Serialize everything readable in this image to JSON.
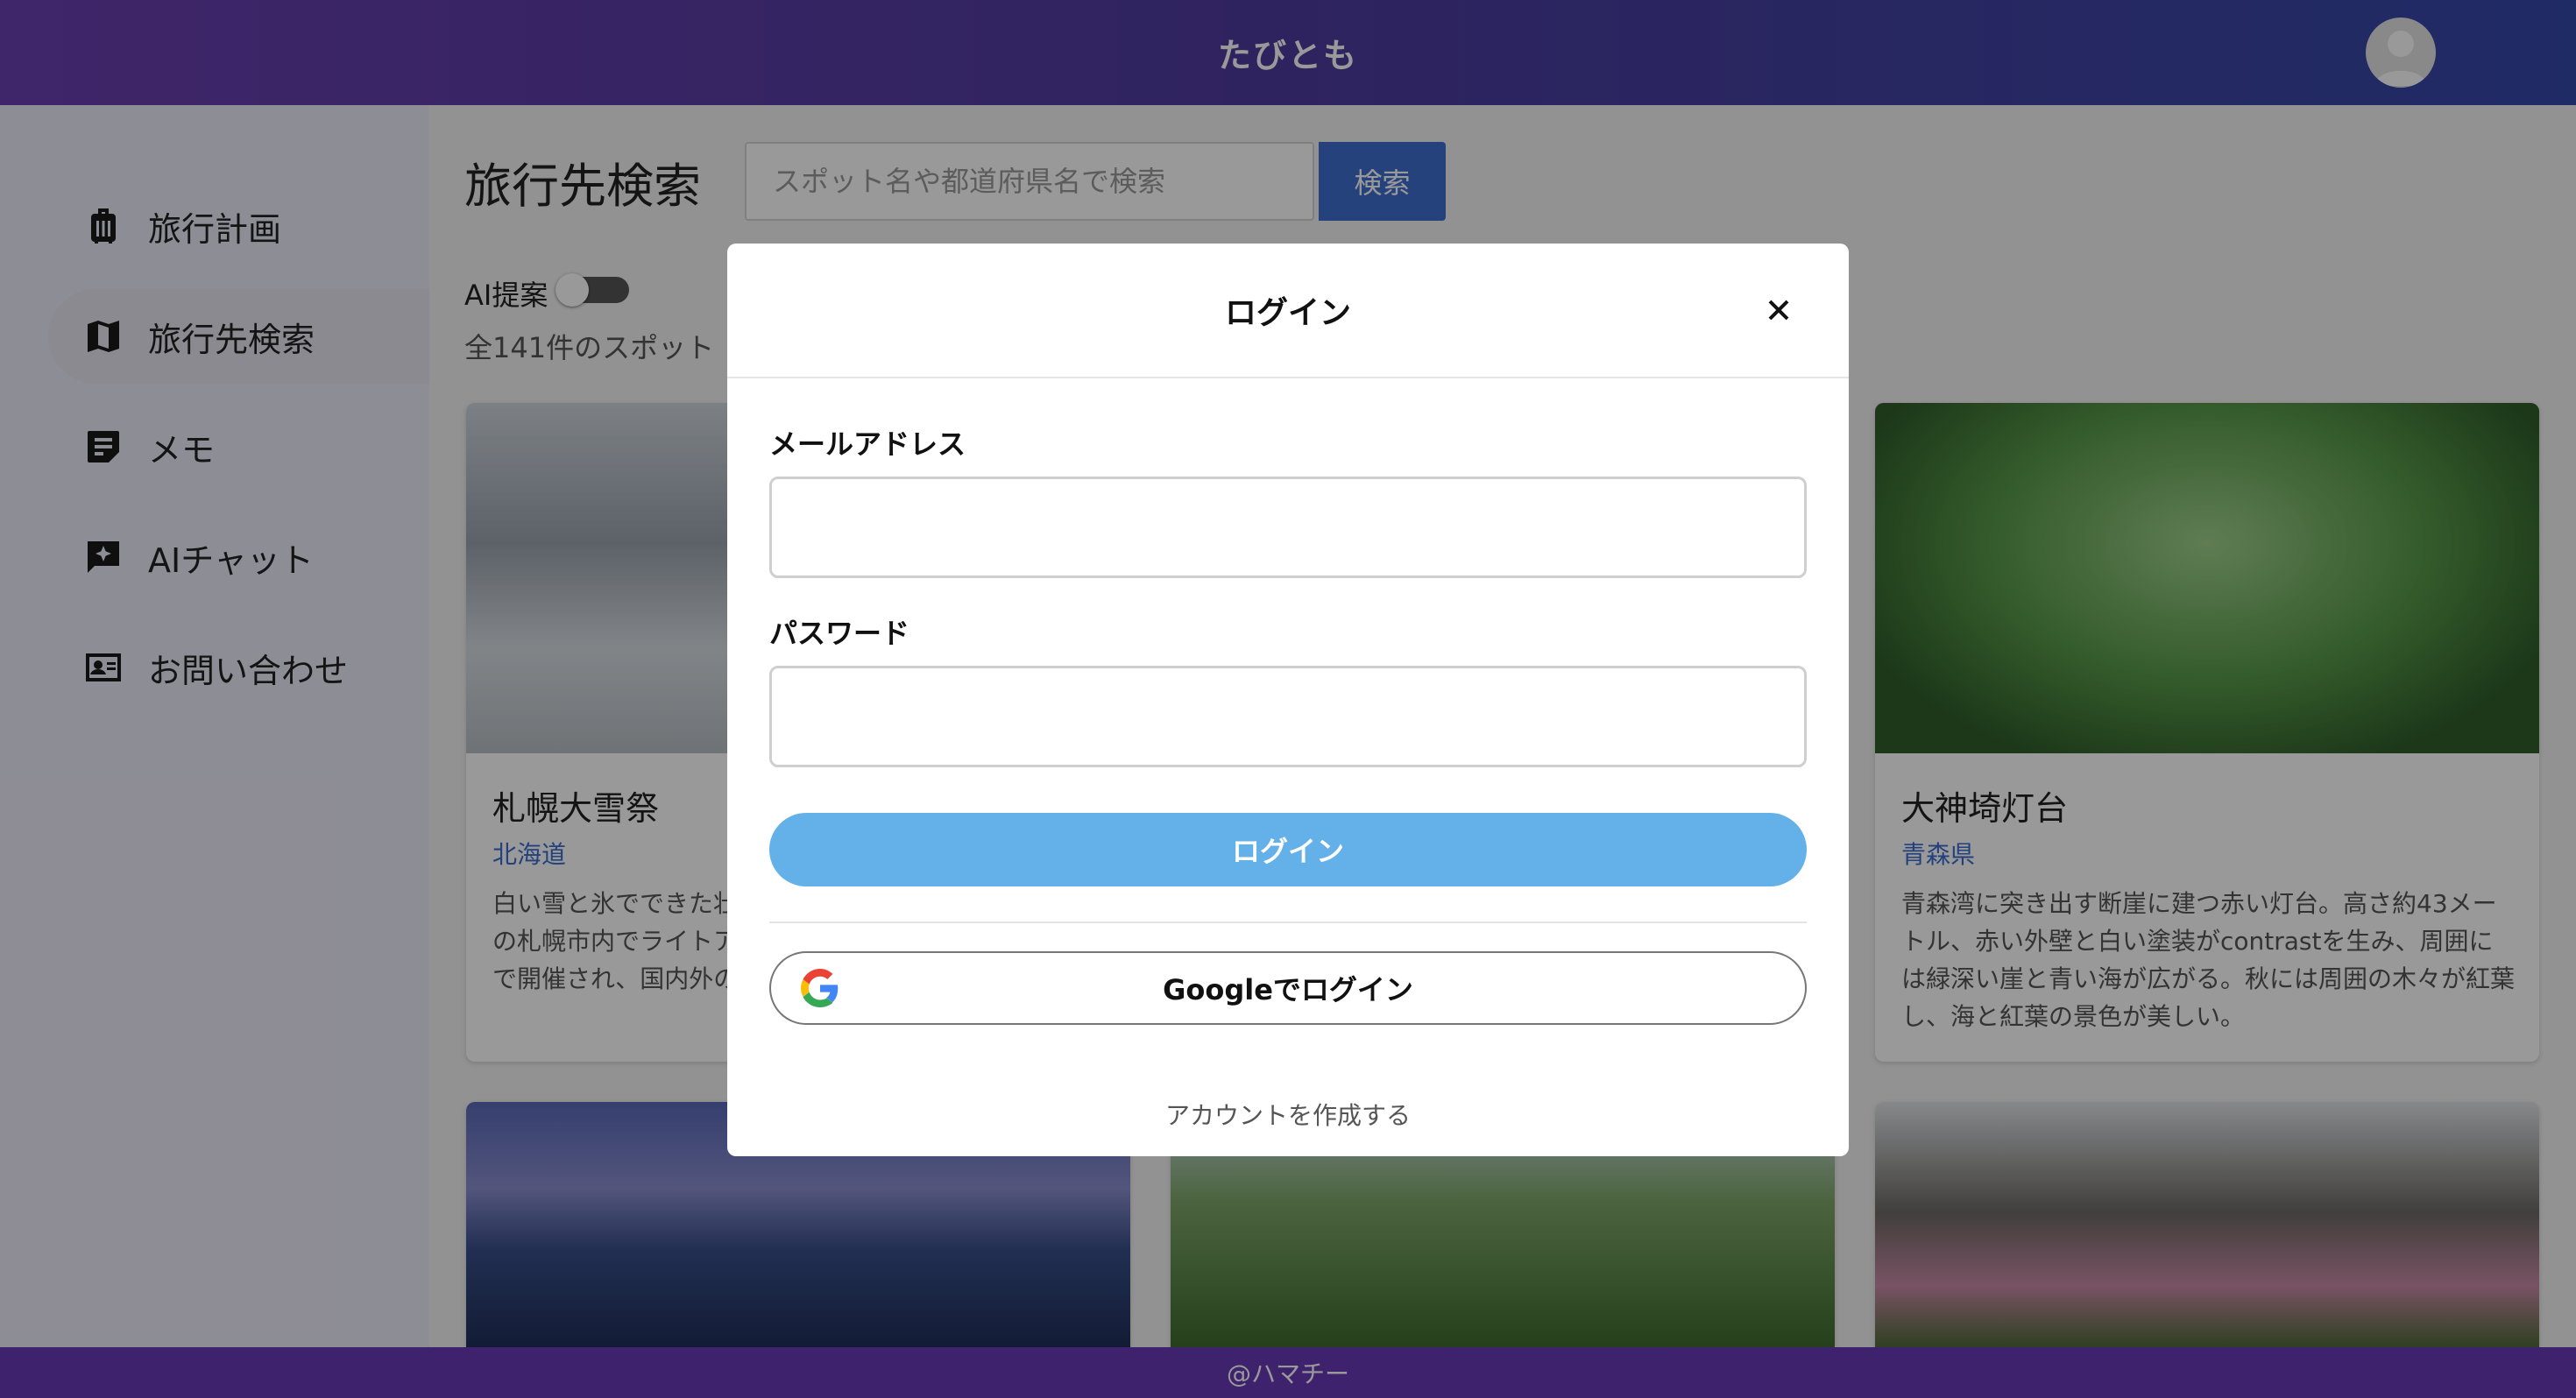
{
  "header": {
    "title": "たびとも",
    "avatar_icon": "user-avatar-icon"
  },
  "sidebar": {
    "items": [
      {
        "label": "旅行計画",
        "icon": "suitcase-icon",
        "active": false
      },
      {
        "label": "旅行先検索",
        "icon": "map-icon",
        "active": true
      },
      {
        "label": "メモ",
        "icon": "note-icon",
        "active": false
      },
      {
        "label": "AIチャット",
        "icon": "ai-chat-icon",
        "active": false
      },
      {
        "label": "お問い合わせ",
        "icon": "contact-card-icon",
        "active": false
      }
    ]
  },
  "main": {
    "page_title": "旅行先検索",
    "search": {
      "placeholder": "スポット名や都道府県名で検索",
      "button_label": "検索"
    },
    "ai_toggle": {
      "label": "AI提案",
      "enabled": false
    },
    "count_text": "全141件のスポット",
    "cards": [
      {
        "title": "札幌大雪祭",
        "prefecture": "北海道",
        "desc": "白い雪と氷でできた壮大な像が立ち並ぶ冬の祭典。真冬の札幌市内でライトアップされ、幻想的な雰囲気の中で開催され、国内外の観光客を魅了する。"
      },
      {
        "title": "大神埼灯台",
        "prefecture": "青森県",
        "desc": "青森湾に突き出す断崖に建つ赤い灯台。高さ約43メートル、赤い外壁と白い塗装がcontrastを生み、周囲には緑深い崖と青い海が広がる。秋には周囲の木々が紅葉し、海と紅葉の景色が美しい。"
      }
    ]
  },
  "footer": {
    "text": "@ハマチー"
  },
  "modal": {
    "title": "ログイン",
    "email_label": "メールアドレス",
    "email_value": "",
    "password_label": "パスワード",
    "password_value": "",
    "login_button": "ログイン",
    "google_button": "Googleでログイン",
    "create_account": "アカウントを作成する"
  },
  "colors": {
    "header_gradient_start": "#6a3fb0",
    "header_gradient_end": "#3548a8",
    "accent_blue": "#3f6fd1",
    "login_button": "#64b0e8",
    "footer": "#6a3ab8"
  }
}
